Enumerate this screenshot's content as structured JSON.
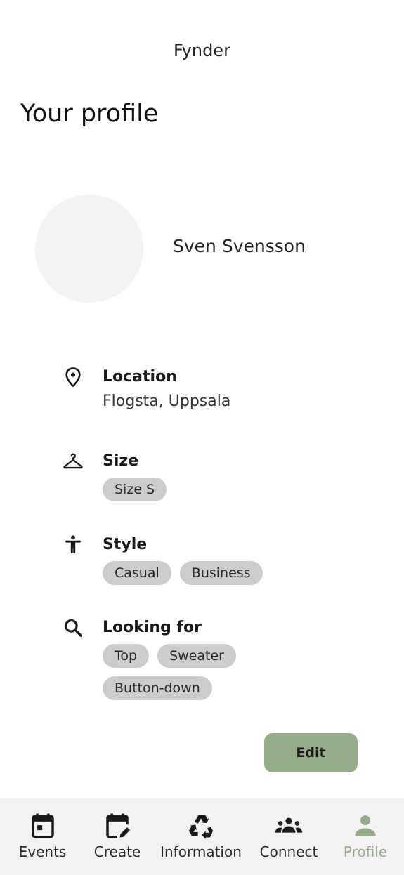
{
  "header": {
    "app_title": "Fynder",
    "page_title": "Your profile"
  },
  "profile": {
    "name": "Sven Svensson"
  },
  "location": {
    "label": "Location",
    "value": "Flogsta, Uppsala",
    "icon": "location-pin-icon"
  },
  "size": {
    "label": "Size",
    "tags": [
      "Size S"
    ],
    "icon": "hanger-icon"
  },
  "style": {
    "label": "Style",
    "tags": [
      "Casual",
      "Business"
    ],
    "icon": "person-icon"
  },
  "looking_for": {
    "label": "Looking for",
    "tags": [
      "Top",
      "Sweater",
      "Button-down"
    ],
    "icon": "search-icon"
  },
  "actions": {
    "edit_label": "Edit"
  },
  "nav": {
    "items": [
      {
        "label": "Events",
        "icon": "calendar-icon"
      },
      {
        "label": "Create",
        "icon": "calendar-edit-icon"
      },
      {
        "label": "Information",
        "icon": "recycle-icon"
      },
      {
        "label": "Connect",
        "icon": "group-icon"
      },
      {
        "label": "Profile",
        "icon": "profile-icon",
        "active": true
      }
    ]
  },
  "colors": {
    "accent": "#94ac87",
    "tag_bg": "#cccccc",
    "nav_bg": "#f2f2f2",
    "avatar_bg": "#f3f3f3"
  }
}
